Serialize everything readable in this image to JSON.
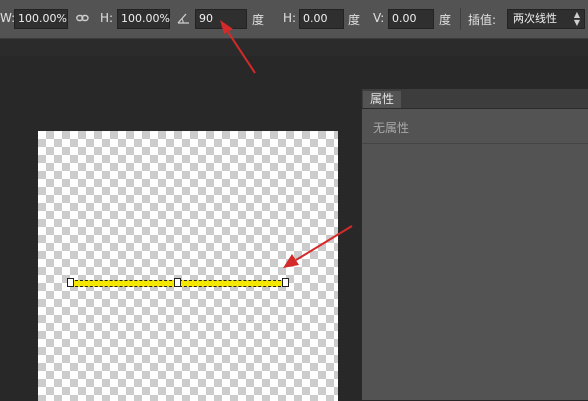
{
  "options_bar": {
    "w_label": "W:",
    "w_value": "100.00%",
    "link_icon": "link-icon",
    "h_label": "H:",
    "h_value": "100.00%",
    "angle_icon": "angle-icon",
    "angle_value": "90",
    "angle_unit": "度",
    "hskew_label": "H:",
    "hskew_value": "0.00",
    "hskew_unit": "度",
    "vskew_label": "V:",
    "vskew_value": "0.00",
    "vskew_unit": "度",
    "interp_label": "插值:",
    "interp_value": "两次线性"
  },
  "properties_panel": {
    "tab_label": "属性",
    "empty_text": "无属性"
  },
  "colors": {
    "annotation_arrow": "#d42a2a",
    "line_fill": "#f5e800"
  }
}
